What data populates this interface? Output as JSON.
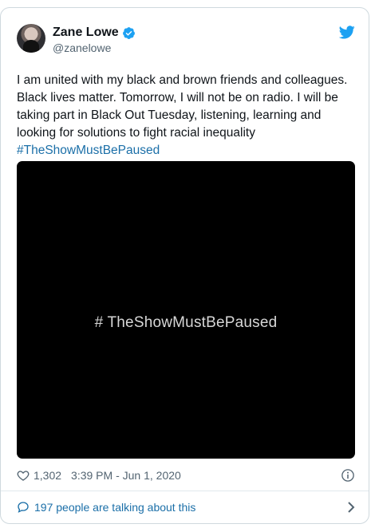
{
  "tweet": {
    "author": {
      "name": "Zane Lowe",
      "handle": "@zanelowe",
      "verified": true
    },
    "text": "I am united with my black and brown friends and colleagues. Black lives matter. Tomorrow, I will not be on radio. I will be taking part in Black Out Tuesday, listening, learning and looking for solutions to fight racial inequality",
    "hashtag": "#TheShowMustBePaused",
    "media": {
      "caption": "# TheShowMustBePaused",
      "background": "#000000"
    },
    "likes": "1,302",
    "timestamp": "3:39 PM - Jun 1, 2020",
    "conversation_link": "197 people are talking about this"
  },
  "colors": {
    "link": "#1b6fa8",
    "twitter_blue": "#1da1f2",
    "secondary_text": "#536471",
    "border": "#cfd9de"
  },
  "icons": [
    "verified-badge-icon",
    "twitter-bird-icon",
    "heart-icon",
    "info-icon",
    "speech-bubble-icon",
    "chevron-right-icon"
  ]
}
